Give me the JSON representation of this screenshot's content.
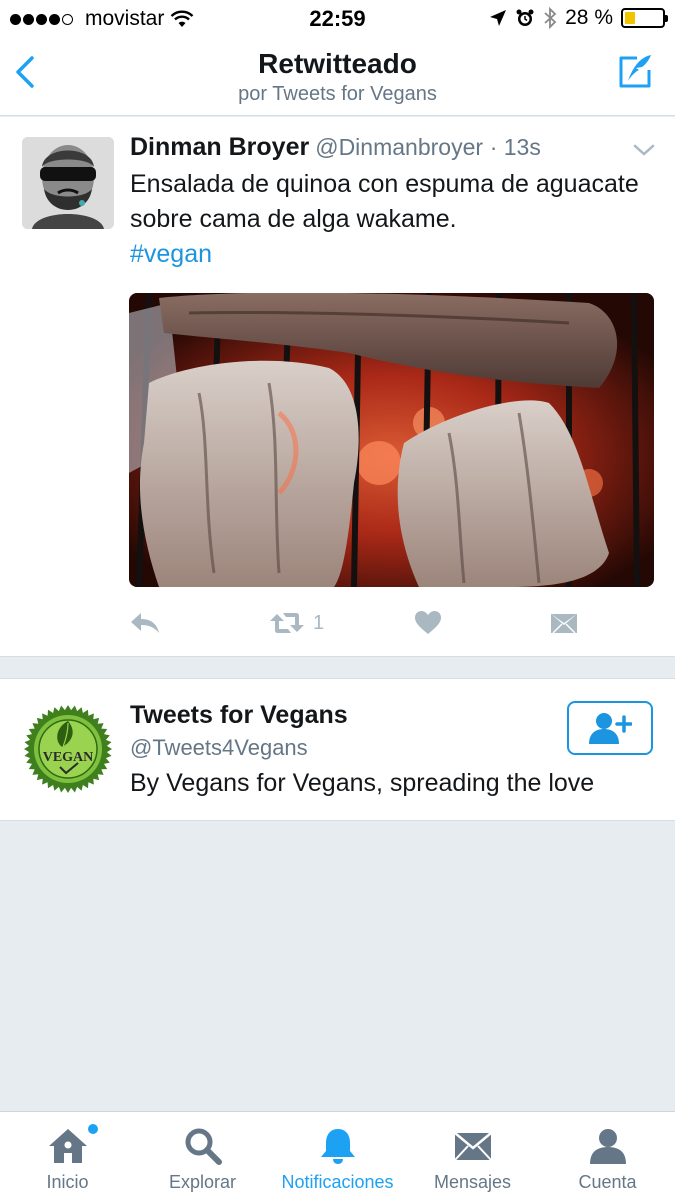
{
  "status_bar": {
    "carrier": "movistar",
    "time": "22:59",
    "battery_text": "28 %",
    "battery_level": 0.28,
    "signal_bars": 4,
    "signal_max": 5
  },
  "nav": {
    "title": "Retwitteado",
    "subtitle": "por Tweets for Vegans"
  },
  "tweet": {
    "author_name": "Dinman Broyer",
    "author_handle": "@Dinmanbroyer",
    "time": "· 13s",
    "text": "Ensalada de quinoa con espuma de aguacate sobre cama de alga wakame.",
    "hashtag": "#vegan",
    "retweet_count": "1"
  },
  "user_card": {
    "name": "Tweets for Vegans",
    "handle": "@Tweets4Vegans",
    "bio": "By Vegans for Vegans, spreading the love",
    "avatar_text": "VEGAN"
  },
  "tabs": [
    {
      "label": "Inicio",
      "icon": "home-icon"
    },
    {
      "label": "Explorar",
      "icon": "search-icon"
    },
    {
      "label": "Notificaciones",
      "icon": "bell-icon"
    },
    {
      "label": "Mensajes",
      "icon": "envelope-icon"
    },
    {
      "label": "Cuenta",
      "icon": "person-icon"
    }
  ],
  "colors": {
    "accent": "#1da1f2",
    "link": "#1b95e0",
    "muted": "#657786",
    "action_gray": "#aab8c2",
    "background": "#e6ecf0",
    "battery_fill": "#f2c400"
  }
}
